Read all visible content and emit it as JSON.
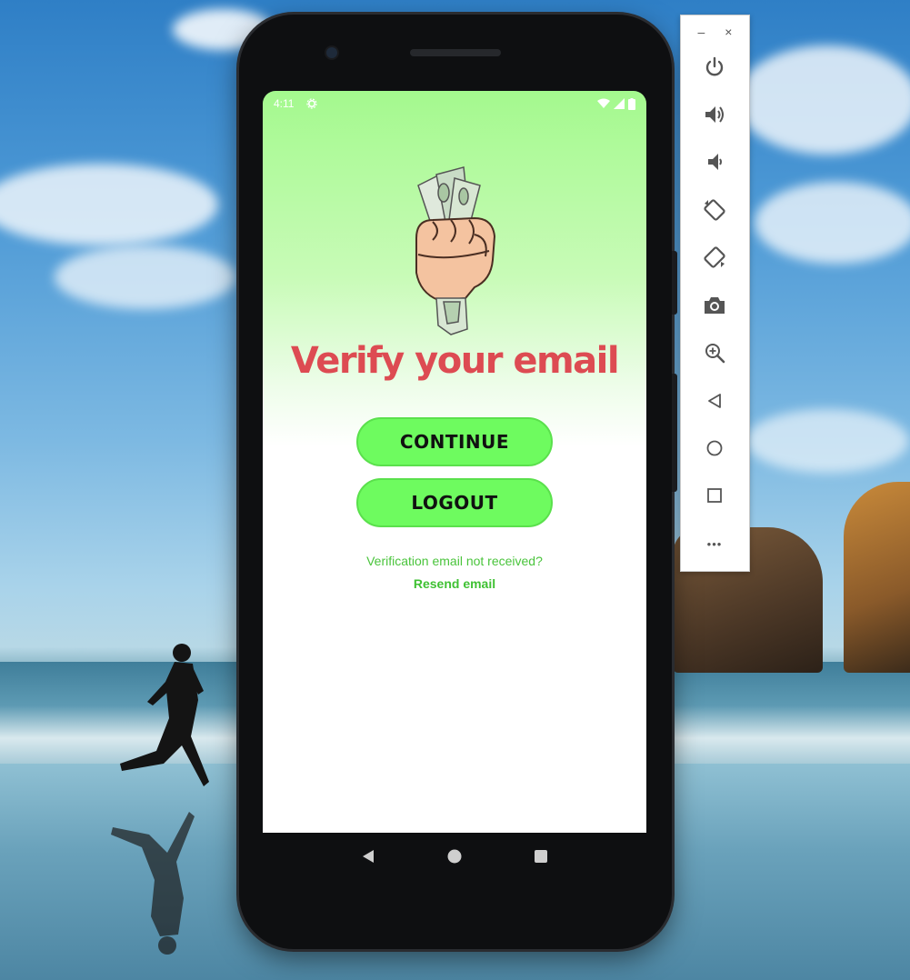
{
  "status_bar": {
    "time": "4:11"
  },
  "app": {
    "title": "Verify your email",
    "continue_label": "CONTINUE",
    "logout_label": "LOGOUT",
    "hint": "Verification email not received?",
    "resend_label": "Resend email"
  },
  "emulator_toolbar": {
    "minimize": "–",
    "close": "×",
    "more": "•••"
  },
  "colors": {
    "accent_green": "#6efb5f",
    "title_red": "#dd4b52",
    "link_green": "#3fc133"
  }
}
